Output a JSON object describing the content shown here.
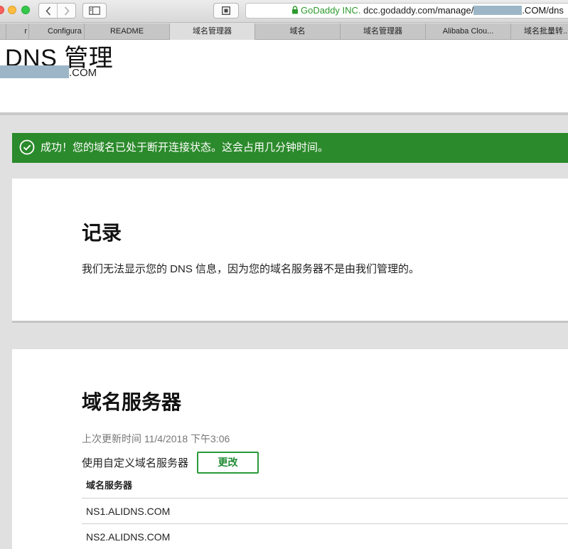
{
  "browser": {
    "url": {
      "secure_label": "GoDaddy INC.",
      "domain": "dcc.godaddy.com",
      "path_prefix": "/manage/",
      "path_suffix": ".COM/dns"
    },
    "tabs": [
      {
        "label": "r",
        "active": false
      },
      {
        "label": "Configura",
        "active": false
      },
      {
        "label": "README",
        "active": false
      },
      {
        "label": "域名管理器",
        "active": true
      },
      {
        "label": "域名",
        "active": false
      },
      {
        "label": "域名管理器",
        "active": false
      },
      {
        "label": "Alibaba Clou...",
        "active": false
      },
      {
        "label": "域名批量转...",
        "active": false
      }
    ]
  },
  "header": {
    "title": "DNS 管理",
    "domain_suffix": ".COM"
  },
  "alert": {
    "message": "成功！您的域名已处于断开连接状态。这会占用几分钟时间。",
    "color": "#2b8a2b"
  },
  "records": {
    "title": "记录",
    "message": "我们无法显示您的 DNS 信息，因为您的域名服务器不是由我们管理的。"
  },
  "nameservers": {
    "title": "域名服务器",
    "last_updated": "上次更新时间 11/4/2018 下午3:06",
    "custom_label": "使用自定义域名服务器",
    "change_button": "更改",
    "table_header": "域名服务器",
    "rows": [
      "NS1.ALIDNS.COM",
      "NS2.ALIDNS.COM"
    ]
  }
}
